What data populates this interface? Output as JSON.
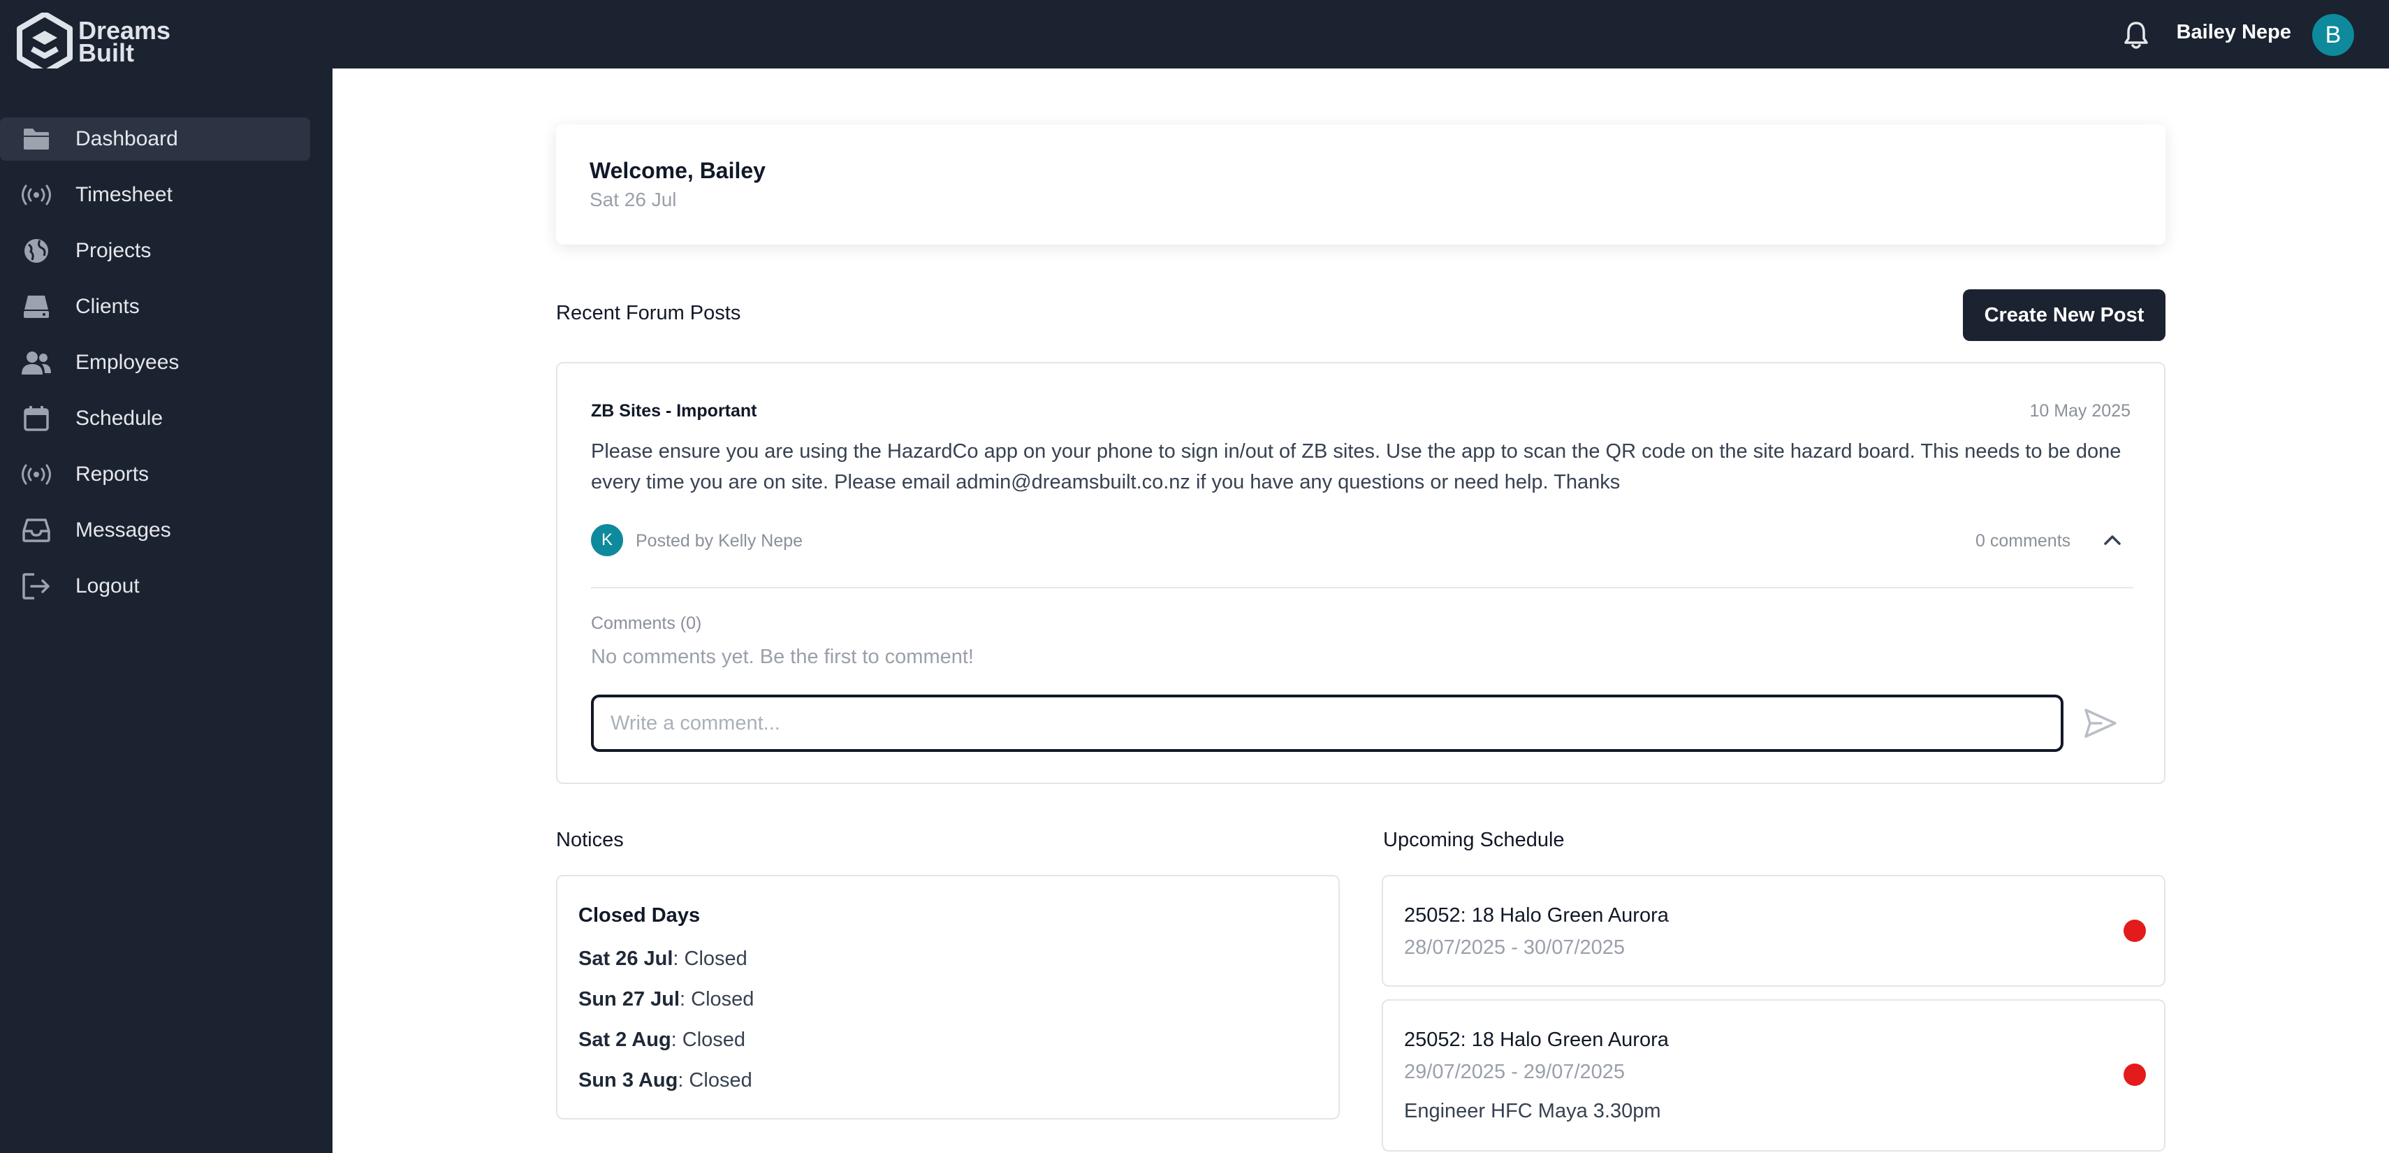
{
  "brand": {
    "line1": "Dreams",
    "line2": "Built"
  },
  "header": {
    "user_name": "Bailey Nepe",
    "user_initial": "B"
  },
  "sidebar": {
    "items": [
      {
        "label": "Dashboard",
        "icon": "folder-icon",
        "active": true
      },
      {
        "label": "Timesheet",
        "icon": "broadcast-icon"
      },
      {
        "label": "Projects",
        "icon": "globe-icon"
      },
      {
        "label": "Clients",
        "icon": "drive-icon"
      },
      {
        "label": "Employees",
        "icon": "users-icon"
      },
      {
        "label": "Schedule",
        "icon": "calendar-icon"
      },
      {
        "label": "Reports",
        "icon": "broadcast-icon"
      },
      {
        "label": "Messages",
        "icon": "inbox-icon"
      },
      {
        "label": "Logout",
        "icon": "logout-icon"
      }
    ]
  },
  "welcome": {
    "title": "Welcome, Bailey",
    "date": "Sat 26 Jul"
  },
  "forum": {
    "section_title": "Recent Forum Posts",
    "create_button": "Create New Post",
    "post": {
      "title": "ZB Sites - Important",
      "date": "10 May 2025",
      "body": "Please ensure you are using the HazardCo app on your phone to sign in/out of ZB sites. Use the app to scan the QR code on the site hazard board. This needs to be done every time you are on site. Please email admin@dreamsbuilt.co.nz if you have any questions or need help. Thanks",
      "author_initial": "K",
      "author": "Posted by Kelly Nepe",
      "comment_count": "0 comments",
      "comments_label": "Comments (0)",
      "no_comments": "No comments yet. Be the first to comment!",
      "comment_placeholder": "Write a comment..."
    }
  },
  "notices": {
    "section_title": "Notices",
    "card_title": "Closed Days",
    "rows": [
      {
        "day": "Sat 26 Jul",
        "status": ": Closed"
      },
      {
        "day": "Sun 27 Jul",
        "status": ": Closed"
      },
      {
        "day": "Sat 2 Aug",
        "status": ": Closed"
      },
      {
        "day": "Sun 3 Aug",
        "status": ": Closed"
      }
    ]
  },
  "schedule": {
    "section_title": "Upcoming Schedule",
    "items": [
      {
        "title": "25052: 18 Halo Green Aurora",
        "dates": "28/07/2025 - 30/07/2025",
        "note": ""
      },
      {
        "title": "25052: 18 Halo Green Aurora",
        "dates": "29/07/2025 - 29/07/2025",
        "note": "Engineer HFC Maya 3.30pm"
      }
    ]
  },
  "colors": {
    "sidebar_bg": "#1b2230",
    "accent_teal": "#0e8a9c",
    "status_red": "#e41b1b"
  }
}
